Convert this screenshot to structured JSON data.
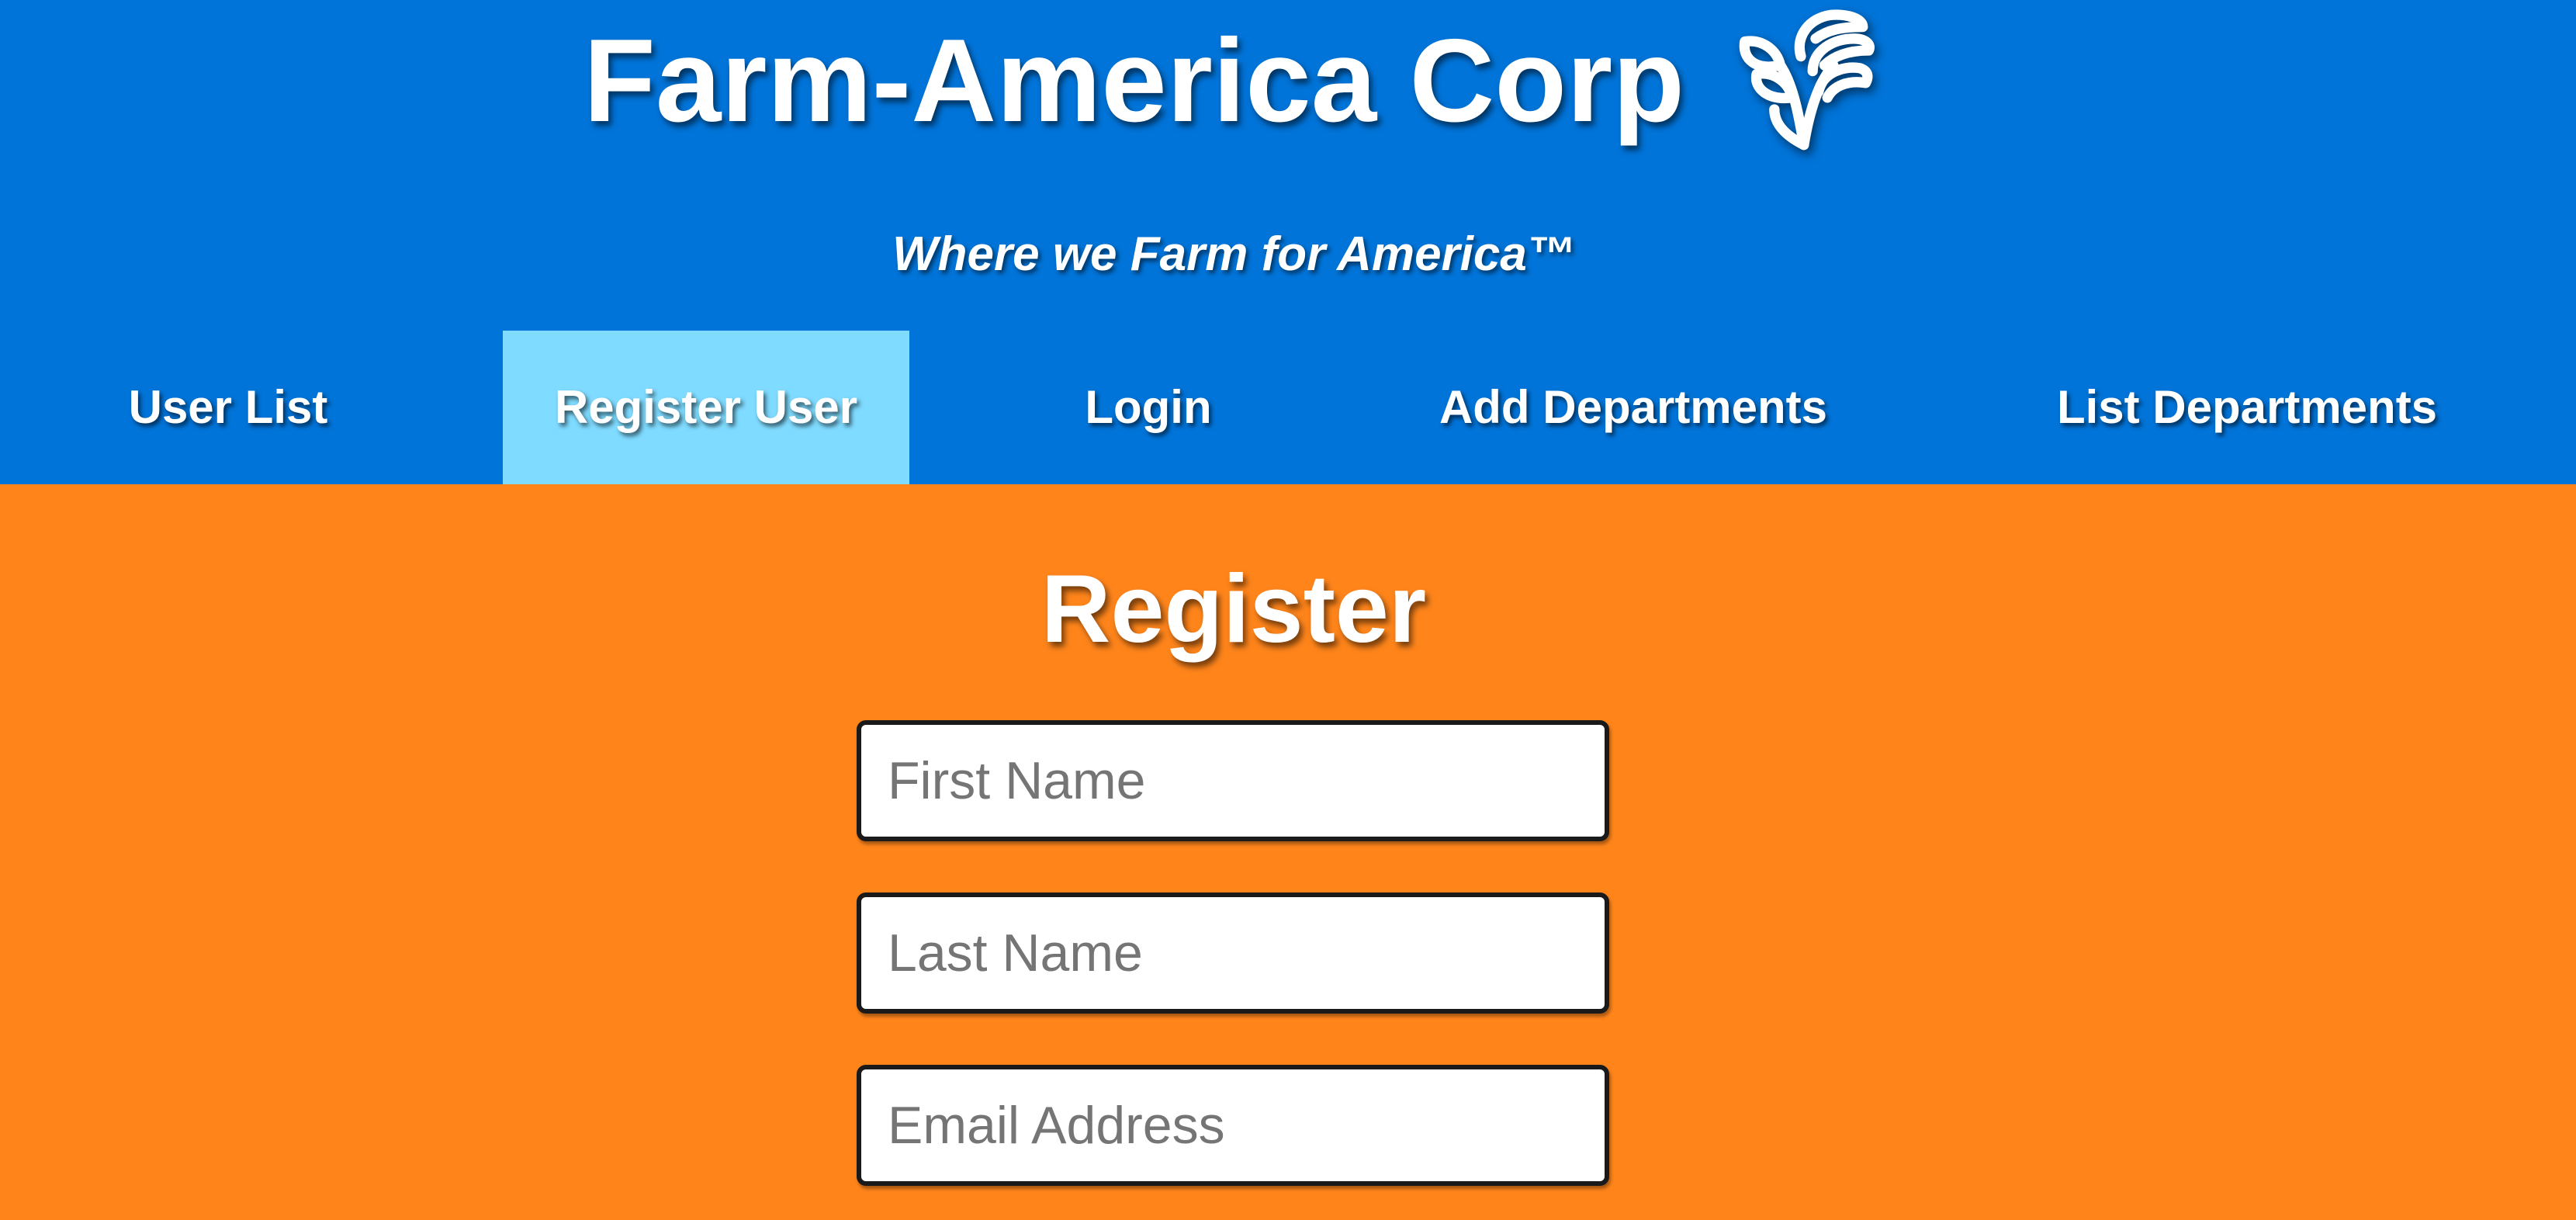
{
  "header": {
    "title": "Farm-America Corp",
    "logo_icon": "wheat-icon",
    "tagline": "Where we Farm for America™",
    "background_color": "#0074d9"
  },
  "nav": {
    "items": [
      {
        "label": "User List",
        "active": false
      },
      {
        "label": "Register User",
        "active": true
      },
      {
        "label": "Login",
        "active": false
      },
      {
        "label": "Add Departments",
        "active": false
      },
      {
        "label": "List Departments",
        "active": false
      }
    ],
    "active_color": "#7fdbff"
  },
  "main": {
    "title": "Register",
    "background_color": "#ff851b",
    "fields": {
      "first_name": {
        "placeholder": "First Name",
        "value": ""
      },
      "last_name": {
        "placeholder": "Last Name",
        "value": ""
      },
      "email": {
        "placeholder": "Email Address",
        "value": ""
      }
    }
  }
}
